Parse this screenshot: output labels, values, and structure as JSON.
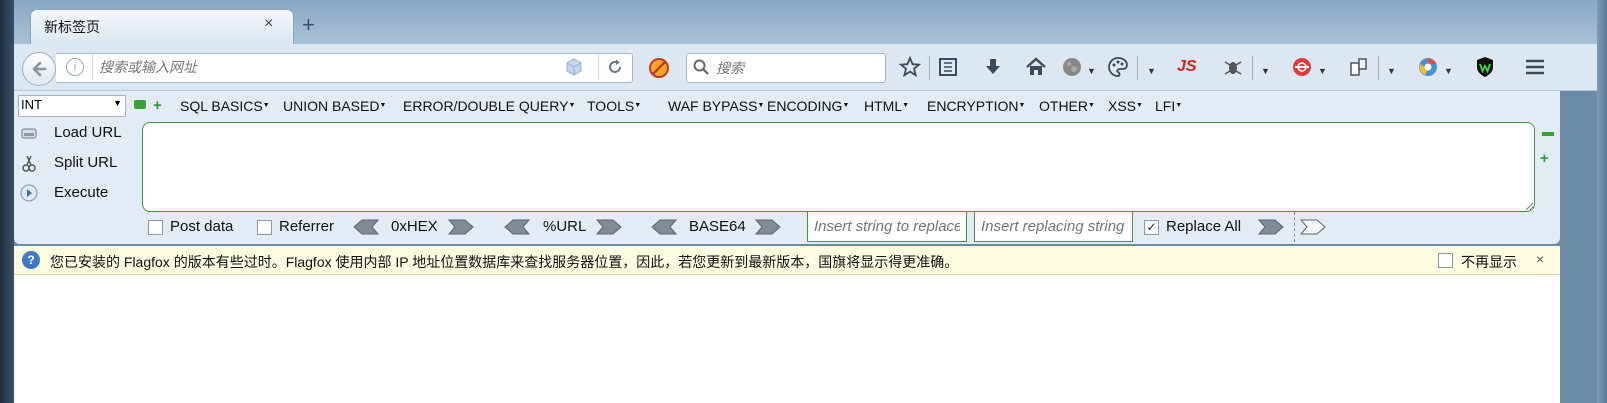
{
  "tab": {
    "title": "新标签页",
    "close": "×",
    "new_tab": "+"
  },
  "toolbar": {
    "url_placeholder": "搜索或输入网址",
    "info": "i",
    "search_placeholder": "搜索",
    "js_label": "JS"
  },
  "hackbar": {
    "select_value": "INT",
    "menus": [
      "SQL BASICS",
      "UNION BASED",
      "ERROR/DOUBLE QUERY",
      "TOOLS",
      "WAF BYPASS",
      "ENCODING",
      "HTML",
      "ENCRYPTION",
      "OTHER",
      "XSS",
      "LFI"
    ],
    "side_buttons": {
      "load": "Load URL",
      "split": "Split URL",
      "execute": "Execute"
    },
    "post_data": "Post data",
    "referrer": "Referrer",
    "encoders": {
      "hex": "0xHEX",
      "url": "%URL",
      "base64": "BASE64"
    },
    "replace_find_placeholder": "Insert string to replace",
    "replace_with_placeholder": "Insert replacing string",
    "replace_all": "Replace All"
  },
  "notification": {
    "icon": "?",
    "text": "您已安装的 Flagfox 的版本有些过时。Flagfox 使用内部 IP 地址位置数据库来查找服务器位置，因此，若您更新到最新版本，国旗将显示得更准确。",
    "dont_show": "不再显示",
    "close": "×"
  },
  "colors": {
    "accent_green": "#3e9a3e",
    "js_red": "#d9201f",
    "info_blue": "#3f78c4"
  },
  "icons": [
    "back-icon",
    "info-icon",
    "cube-icon",
    "reload-icon",
    "block-icon",
    "search-icon",
    "star-icon",
    "reader-icon",
    "download-icon",
    "home-icon",
    "moon-icon",
    "palette-icon",
    "js-icon",
    "bug-icon",
    "shield-red-icon",
    "tabs-icon",
    "chrome-icon",
    "wot-shield-icon",
    "menu-icon"
  ]
}
